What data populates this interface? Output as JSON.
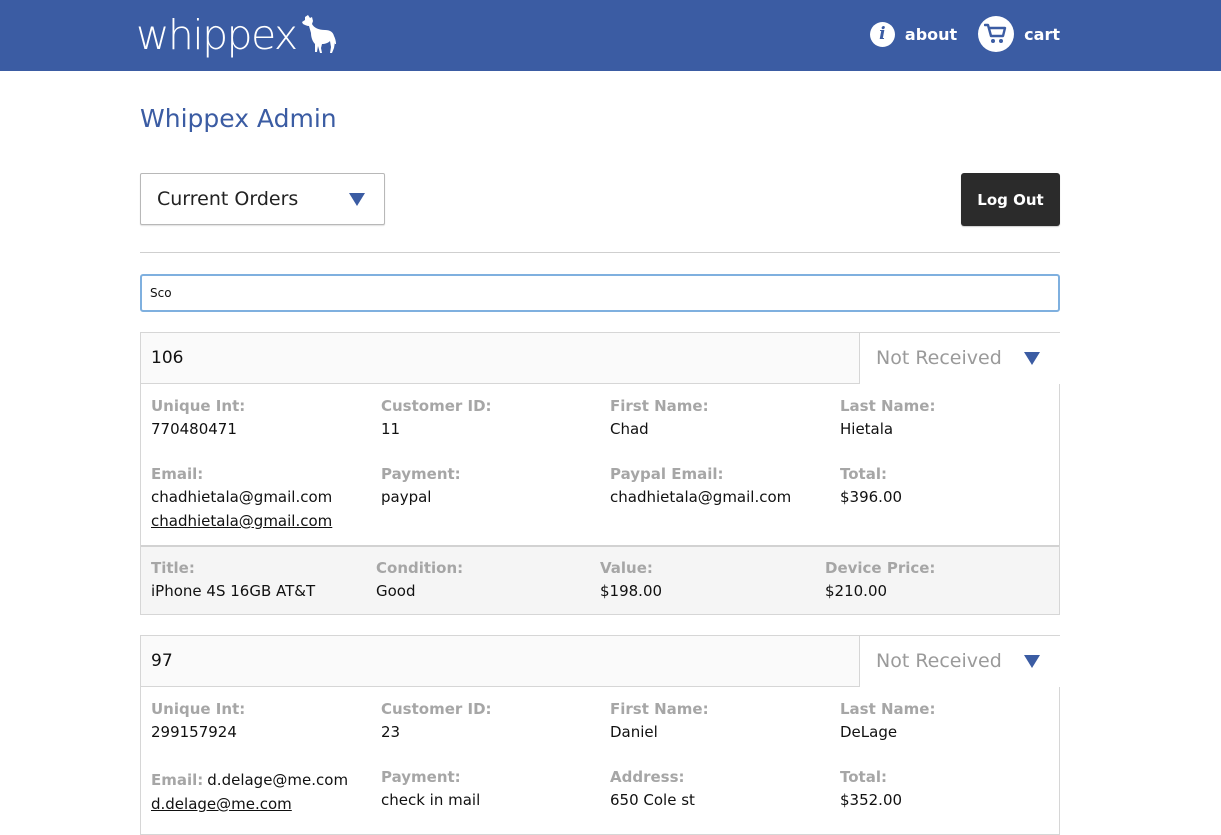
{
  "header": {
    "brand": "whippex",
    "nav": {
      "about": "about",
      "cart": "cart"
    },
    "brand_color": "#3b5ca3"
  },
  "page": {
    "title": "Whippex Admin",
    "view_select": "Current Orders",
    "logout_label": "Log Out",
    "search_value": "Sco"
  },
  "orders": [
    {
      "id": "106",
      "status": "Not Received",
      "fields": {
        "unique_int": {
          "label": "Unique Int:",
          "value": "770480471"
        },
        "customer_id": {
          "label": "Customer ID:",
          "value": "11"
        },
        "first_name": {
          "label": "First Name:",
          "value": "Chad"
        },
        "last_name": {
          "label": "Last Name:",
          "value": "Hietala"
        },
        "email": {
          "label": "Email:",
          "value": "chadhietala@gmail.com",
          "link": "chadhietala@gmail.com"
        },
        "payment": {
          "label": "Payment:",
          "value": "paypal"
        },
        "paypal_email": {
          "label": "Paypal Email:",
          "value": "chadhietala@gmail.com"
        },
        "total": {
          "label": "Total:",
          "value": "$396.00"
        }
      },
      "items": [
        {
          "title": {
            "label": "Title:",
            "value": "iPhone 4S 16GB AT&T"
          },
          "condition": {
            "label": "Condition:",
            "value": "Good"
          },
          "value": {
            "label": "Value:",
            "value": "$198.00"
          },
          "device_price": {
            "label": "Device Price:",
            "value": "$210.00"
          }
        }
      ]
    },
    {
      "id": "97",
      "status": "Not Received",
      "fields": {
        "unique_int": {
          "label": "Unique Int:",
          "value": "299157924"
        },
        "customer_id": {
          "label": "Customer ID:",
          "value": "23"
        },
        "first_name": {
          "label": "First Name:",
          "value": "Daniel"
        },
        "last_name": {
          "label": "Last Name:",
          "value": "DeLage"
        },
        "email": {
          "label": "Email:",
          "value": "d.delage@me.com",
          "link": "d.delage@me.com"
        },
        "payment": {
          "label": "Payment:",
          "value": "check in mail"
        },
        "address": {
          "label": "Address:",
          "value": "650 Cole st"
        },
        "total": {
          "label": "Total:",
          "value": "$352.00"
        }
      }
    }
  ]
}
